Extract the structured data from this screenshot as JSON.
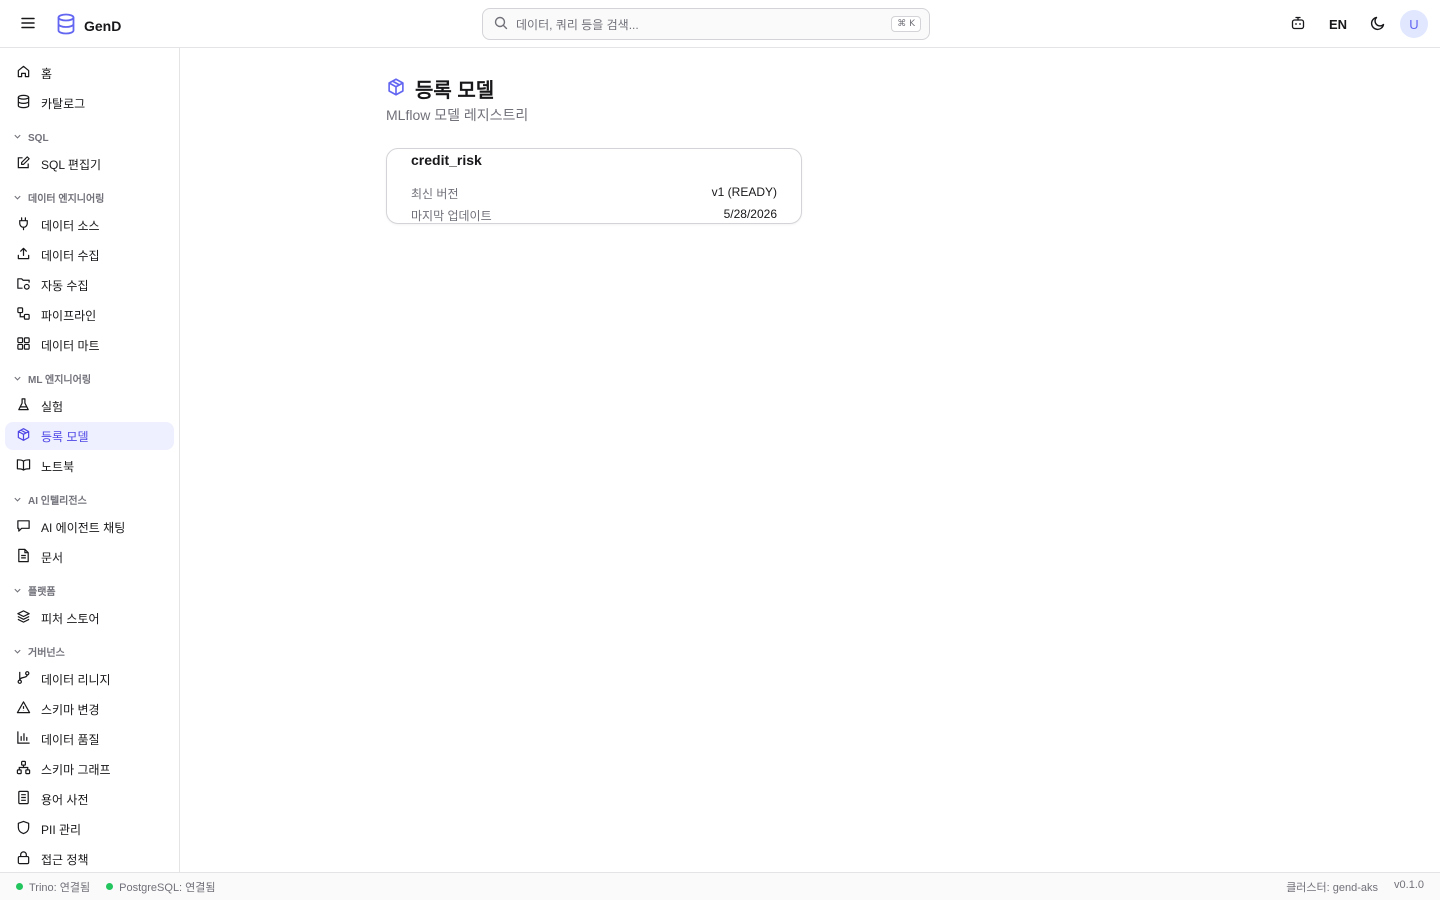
{
  "app": {
    "name": "GenD",
    "brand_color": "#6366f1"
  },
  "header": {
    "search_placeholder": "데이터, 쿼리 등을 검색...",
    "search_shortcut": "⌘ K",
    "language": "EN",
    "avatar_initial": "U"
  },
  "sidebar": {
    "top": [
      {
        "label": "홈",
        "icon": "home-icon"
      },
      {
        "label": "카탈로그",
        "icon": "database-icon"
      }
    ],
    "sections": [
      {
        "title": "SQL",
        "items": [
          {
            "label": "SQL 편집기",
            "icon": "edit-icon"
          }
        ]
      },
      {
        "title": "데이터 엔지니어링",
        "items": [
          {
            "label": "데이터 소스",
            "icon": "plug-icon"
          },
          {
            "label": "데이터 수집",
            "icon": "upload-icon"
          },
          {
            "label": "자동 수집",
            "icon": "folder-sync-icon"
          },
          {
            "label": "파이프라인",
            "icon": "workflow-icon"
          },
          {
            "label": "데이터 마트",
            "icon": "grid-icon"
          }
        ]
      },
      {
        "title": "ML 엔지니어링",
        "items": [
          {
            "label": "실험",
            "icon": "flask-icon"
          },
          {
            "label": "등록 모델",
            "icon": "package-icon",
            "active": true
          },
          {
            "label": "노트북",
            "icon": "book-icon"
          }
        ]
      },
      {
        "title": "AI 인텔리전스",
        "items": [
          {
            "label": "AI 에이전트 채팅",
            "icon": "chat-icon"
          },
          {
            "label": "문서",
            "icon": "document-icon"
          }
        ]
      },
      {
        "title": "플랫폼",
        "items": [
          {
            "label": "피처 스토어",
            "icon": "layers-icon"
          }
        ]
      },
      {
        "title": "거버넌스",
        "items": [
          {
            "label": "데이터 리니지",
            "icon": "git-branch-icon"
          },
          {
            "label": "스키마 변경",
            "icon": "warning-icon"
          },
          {
            "label": "데이터 품질",
            "icon": "bar-chart-icon"
          },
          {
            "label": "스키마 그래프",
            "icon": "network-icon"
          },
          {
            "label": "용어 사전",
            "icon": "list-icon"
          },
          {
            "label": "PII 관리",
            "icon": "shield-icon"
          },
          {
            "label": "접근 정책",
            "icon": "lock-icon"
          }
        ]
      }
    ]
  },
  "main": {
    "title": "등록 모델",
    "subtitle": "MLflow 모델 레지스트리",
    "models": [
      {
        "name": "credit_risk",
        "latest_version_label": "최신 버전",
        "latest_version_value": "v1 (READY)",
        "updated_label": "마지막 업데이트",
        "updated_value": "5/28/2026"
      }
    ]
  },
  "footer": {
    "trino": "Trino: 연결됨",
    "postgres": "PostgreSQL: 연결됨",
    "cluster": "클러스터: gend-aks",
    "version": "v0.1.0",
    "status_color": "#22c55e"
  }
}
